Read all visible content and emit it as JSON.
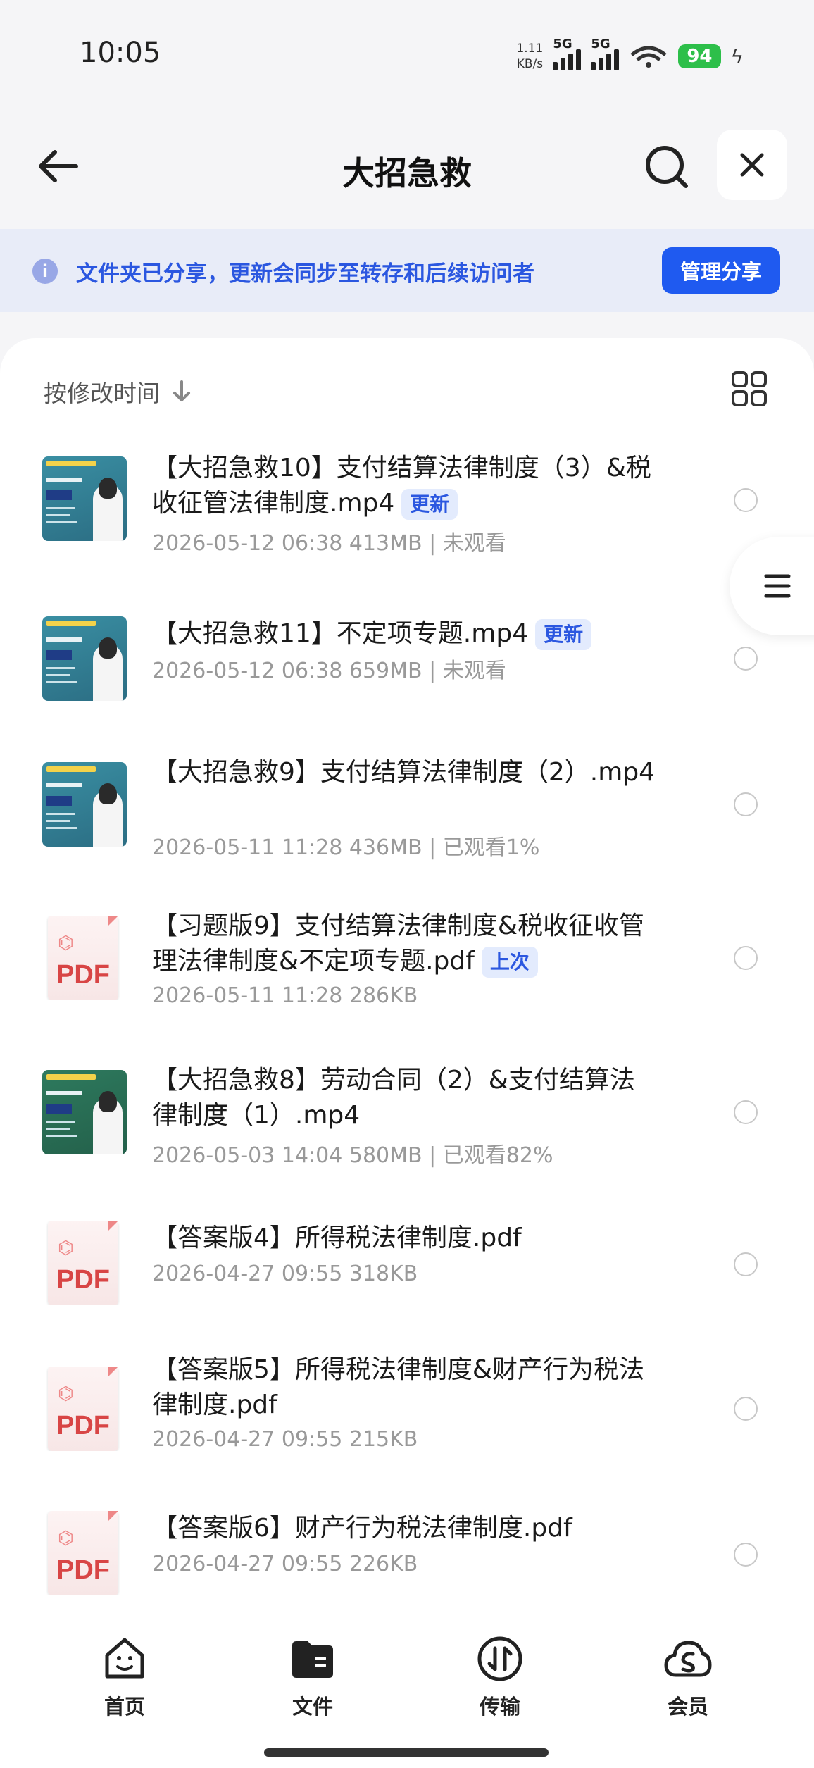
{
  "status": {
    "time": "10:05",
    "speed_value": "1.11",
    "speed_unit": "KB/s",
    "signal1": "5G",
    "signal2": "5G",
    "battery": "94"
  },
  "header": {
    "title": "大招急救"
  },
  "banner": {
    "text": "文件夹已分享，更新会同步至转存和后续访问者",
    "button": "管理分享"
  },
  "toolbar": {
    "sort_label": "按修改时间"
  },
  "files": [
    {
      "name": "【大招急救10】支付结算法律制度（3）&税收征管法律制度.mp4",
      "badge": "更新",
      "meta": "2026-05-12 06:38  413MB | 未观看",
      "type": "video"
    },
    {
      "name": "【大招急救11】不定项专题.mp4",
      "badge": "更新",
      "meta": "2026-05-12 06:38  659MB | 未观看",
      "type": "video"
    },
    {
      "name": "【大招急救9】支付结算法律制度（2）.mp4",
      "badge": "",
      "meta": "2026-05-11 11:28  436MB | 已观看1%",
      "type": "video"
    },
    {
      "name": "【习题版9】支付结算法律制度&税收征收管理法律制度&不定项专题.pdf",
      "badge": "上次",
      "meta": "2026-05-11 11:28  286KB",
      "type": "pdf"
    },
    {
      "name": "【大招急救8】劳动合同（2）&支付结算法律制度（1）.mp4",
      "badge": "",
      "meta": "2026-05-03 14:04  580MB | 已观看82%",
      "type": "video"
    },
    {
      "name": "【答案版4】所得税法律制度.pdf",
      "badge": "",
      "meta": "2026-04-27 09:55  318KB",
      "type": "pdf"
    },
    {
      "name": "【答案版5】所得税法律制度&财产行为税法律制度.pdf",
      "badge": "",
      "meta": "2026-04-27 09:55  215KB",
      "type": "pdf"
    },
    {
      "name": "【答案版6】财产行为税法律制度.pdf",
      "badge": "",
      "meta": "2026-04-27 09:55  226KB",
      "type": "pdf"
    }
  ],
  "pdf_label": "PDF",
  "nav": [
    {
      "label": "首页",
      "icon": "home-smile-icon"
    },
    {
      "label": "文件",
      "icon": "folder-icon"
    },
    {
      "label": "传输",
      "icon": "transfer-icon"
    },
    {
      "label": "会员",
      "icon": "vip-cloud-icon"
    }
  ]
}
